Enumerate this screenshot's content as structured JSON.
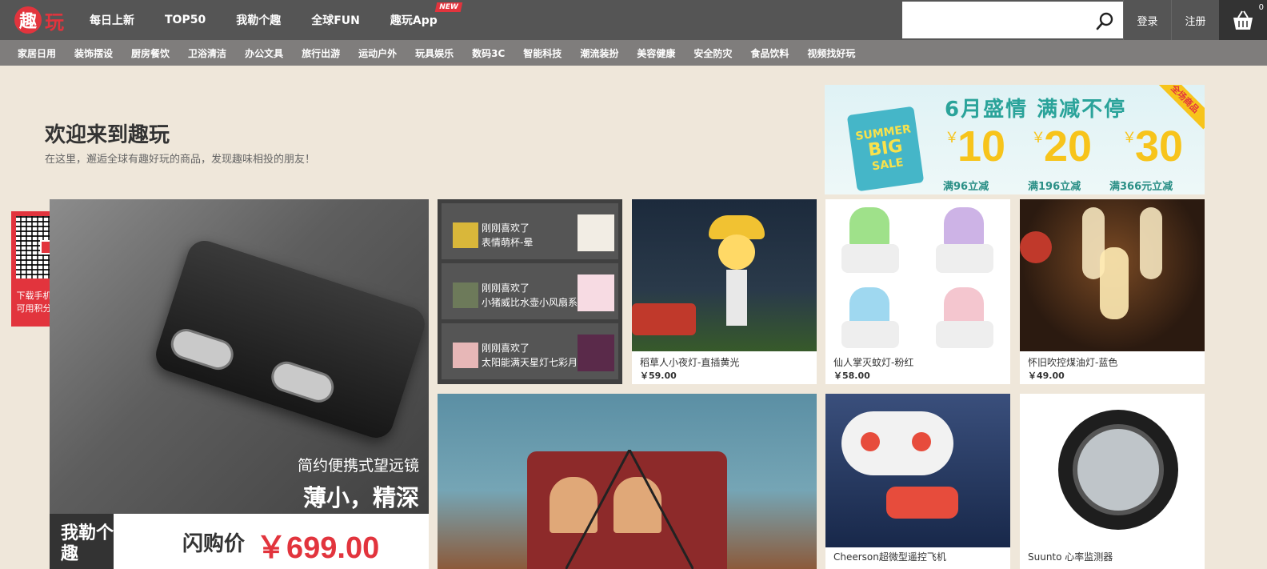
{
  "header": {
    "logo_mark": "趣",
    "logo_text": "玩",
    "nav": [
      {
        "label": "每日上新"
      },
      {
        "label": "TOP50"
      },
      {
        "label": "我勒个趣"
      },
      {
        "label": "全球FUN"
      },
      {
        "label": "趣玩App",
        "badge": "NEW"
      }
    ],
    "search": {
      "placeholder": ""
    },
    "login": "登录",
    "register": "注册",
    "cart_count": "0"
  },
  "categories": [
    "家居日用",
    "装饰摆设",
    "厨房餐饮",
    "卫浴清洁",
    "办公文具",
    "旅行出游",
    "运动户外",
    "玩具娱乐",
    "数码3C",
    "智能科技",
    "潮流装扮",
    "美容健康",
    "安全防灾",
    "食品饮料",
    "视频找好玩"
  ],
  "welcome": {
    "title": "欢迎来到趣玩",
    "subtitle": "在这里，邂逅全球有趣好玩的商品，发现趣味相投的朋友！"
  },
  "promo": {
    "headline": "6月盛情 满减不停",
    "corner": "全场商品",
    "bag_text": [
      "SUMMER",
      "BIG",
      "SALE"
    ],
    "offers": [
      {
        "amount": "10",
        "condition": "满96立减"
      },
      {
        "amount": "20",
        "condition": "满196立减"
      },
      {
        "amount": "30",
        "condition": "满366元立减"
      }
    ],
    "yen": "￥"
  },
  "qr": {
    "line1": "下载手机客户端",
    "line2": "可用积分抵现金"
  },
  "hero": {
    "caption1": "简约便携式望远镜",
    "caption2": "薄小，精深",
    "tag": "我勒个趣",
    "flash": "闪购价",
    "price": "￥699.00"
  },
  "activity": [
    {
      "action": "刚刚喜欢了",
      "item": "表情萌杯-晕"
    },
    {
      "action": "刚刚喜欢了",
      "item": "小猪威比水壶小风扇系"
    },
    {
      "action": "刚刚喜欢了",
      "item": "太阳能满天星灯七彩月"
    }
  ],
  "products": [
    {
      "name": "稻草人小夜灯-直插黄光",
      "price": "￥59.00"
    },
    {
      "name": "仙人掌灭蚊灯-粉红",
      "price": "￥58.00"
    },
    {
      "name": "怀旧吹控煤油灯-蓝色",
      "price": "￥49.00"
    },
    {
      "name": "Cheerson超微型遥控飞机",
      "price": ""
    },
    {
      "name": "Suunto 心率监测器",
      "price": ""
    }
  ],
  "colors": {
    "brand_red": "#e2343d",
    "topbar": "#555555",
    "catbar": "#7f7d7c",
    "page_bg": "#efe7da"
  }
}
